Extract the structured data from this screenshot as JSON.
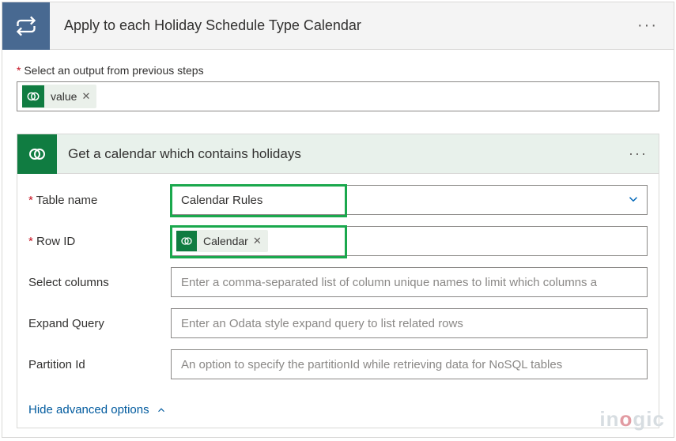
{
  "applyToEach": {
    "title": "Apply to each Holiday Schedule Type Calendar",
    "outputLabel": "Select an output from previous steps",
    "outputToken": {
      "label": "value",
      "icon": "dataverse-icon"
    }
  },
  "innerAction": {
    "title": "Get a calendar which contains holidays",
    "params": {
      "tableName": {
        "label": "Table name",
        "value": "Calendar Rules",
        "required": true
      },
      "rowId": {
        "label": "Row ID",
        "required": true,
        "token": {
          "label": "Calendar",
          "icon": "dataverse-icon"
        }
      },
      "selectCols": {
        "label": "Select columns",
        "placeholder": "Enter a comma-separated list of column unique names to limit which columns a"
      },
      "expand": {
        "label": "Expand Query",
        "placeholder": "Enter an Odata style expand query to list related rows"
      },
      "partition": {
        "label": "Partition Id",
        "placeholder": "An option to specify the partitionId while retrieving data for NoSQL tables"
      }
    },
    "advancedLink": "Hide advanced options"
  },
  "watermark": "inogic"
}
